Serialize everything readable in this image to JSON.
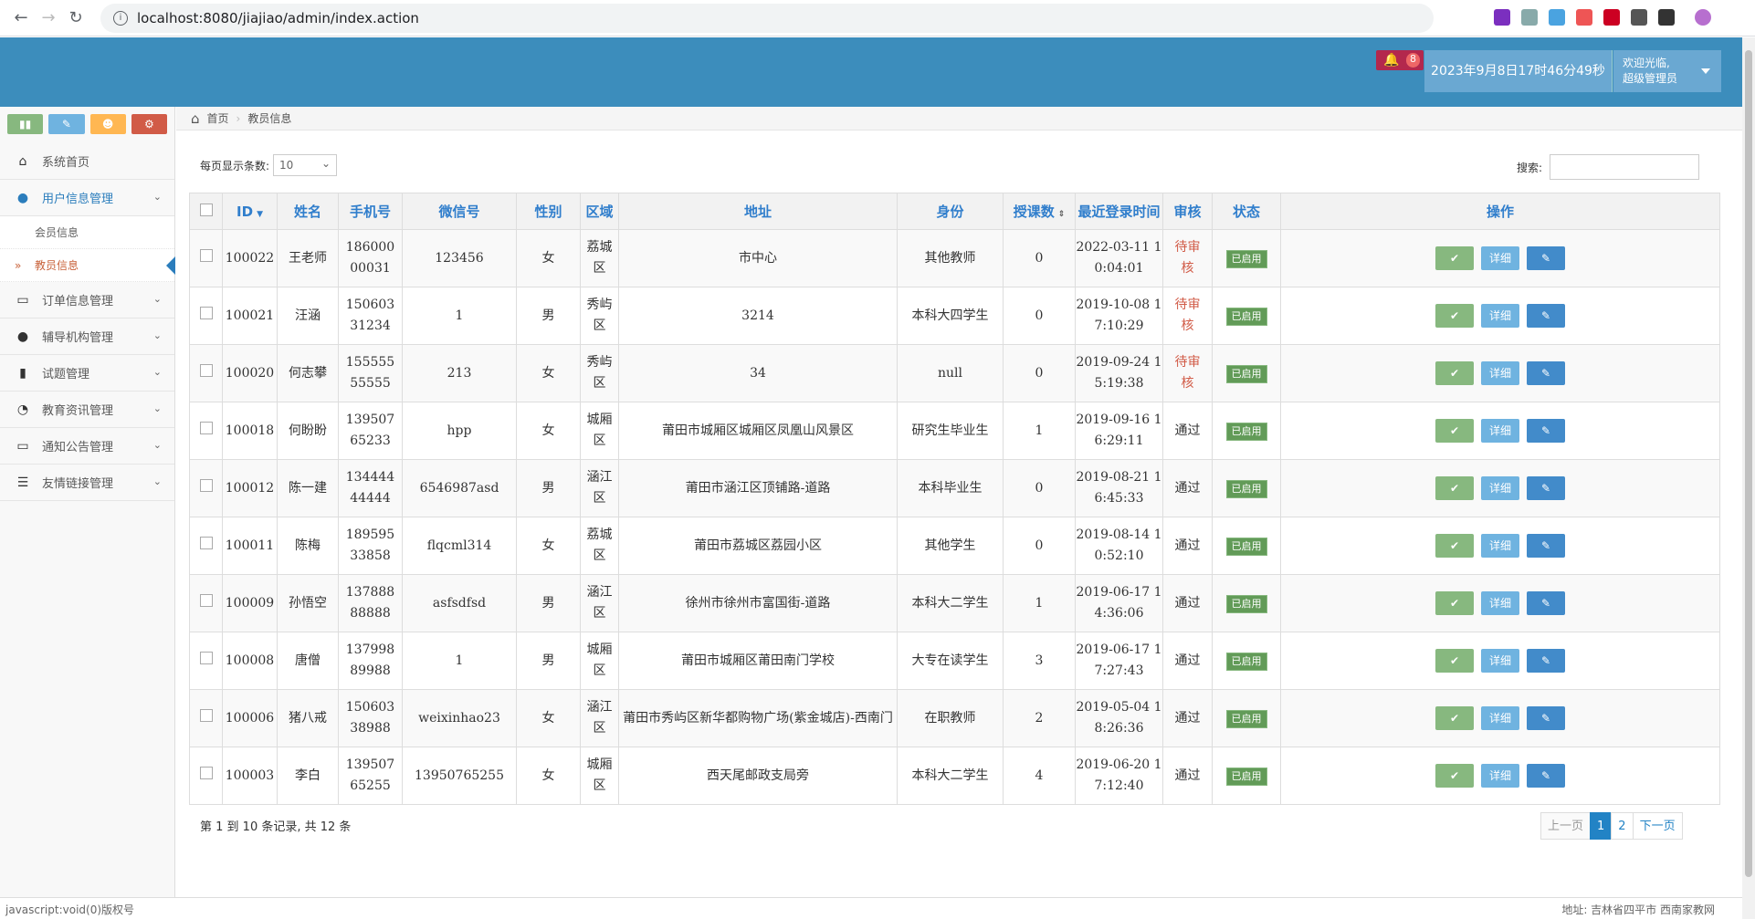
{
  "browser": {
    "url": "localhost:8080/jiajiao/admin/index.action"
  },
  "header": {
    "notification_count": "8",
    "datetime": "2023年9月8日17时46分49秒",
    "welcome": "欢迎光临,",
    "user_role": "超级管理员"
  },
  "sidebar": {
    "items": [
      {
        "label": "系统首页",
        "icon": "home-icon"
      },
      {
        "label": "用户信息管理",
        "icon": "user-icon",
        "subitems": [
          {
            "label": "会员信息"
          },
          {
            "label": "教员信息"
          }
        ]
      },
      {
        "label": "订单信息管理",
        "icon": "credit-card-icon"
      },
      {
        "label": "辅导机构管理",
        "icon": "user-icon"
      },
      {
        "label": "试题管理",
        "icon": "bookmark-icon"
      },
      {
        "label": "教育资讯管理",
        "icon": "comments-icon"
      },
      {
        "label": "通知公告管理",
        "icon": "desktop-icon"
      },
      {
        "label": "友情链接管理",
        "icon": "list-icon"
      }
    ]
  },
  "breadcrumb": {
    "home": "首页",
    "current": "教员信息"
  },
  "controls": {
    "page_size_label": "每页显示条数:",
    "page_size": "10",
    "search_label": "搜索:"
  },
  "table": {
    "columns": [
      "ID",
      "姓名",
      "手机号",
      "微信号",
      "性别",
      "区域",
      "地址",
      "身份",
      "授课数",
      "最近登录时间",
      "审核",
      "状态",
      "操作"
    ],
    "rows": [
      {
        "id": "100022",
        "name": "王老师",
        "phone": [
          "186000",
          "00031"
        ],
        "wechat": "123456",
        "gender": "女",
        "area": [
          "荔城",
          "区"
        ],
        "address": "市中心",
        "identity": "其他教师",
        "lessons": "0",
        "login": [
          "2022-03-11 1",
          "0:04:01"
        ],
        "review": [
          "待审",
          "核"
        ],
        "status": "已启用"
      },
      {
        "id": "100021",
        "name": "汪涵",
        "phone": [
          "150603",
          "31234"
        ],
        "wechat": "1",
        "gender": "男",
        "area": [
          "秀屿",
          "区"
        ],
        "address": "3214",
        "identity": "本科大四学生",
        "lessons": "0",
        "login": [
          "2019-10-08 1",
          "7:10:29"
        ],
        "review": [
          "待审",
          "核"
        ],
        "status": "已启用"
      },
      {
        "id": "100020",
        "name": "何志攀",
        "phone": [
          "155555",
          "55555"
        ],
        "wechat": "213",
        "gender": "女",
        "area": [
          "秀屿",
          "区"
        ],
        "address": "34",
        "identity": "null",
        "lessons": "0",
        "login": [
          "2019-09-24 1",
          "5:19:38"
        ],
        "review": [
          "待审",
          "核"
        ],
        "status": "已启用"
      },
      {
        "id": "100018",
        "name": "何盼盼",
        "phone": [
          "139507",
          "65233"
        ],
        "wechat": "hpp",
        "gender": "女",
        "area": [
          "城厢",
          "区"
        ],
        "address": "莆田市城厢区城厢区凤凰山风景区",
        "identity": "研究生毕业生",
        "lessons": "1",
        "login": [
          "2019-09-16 1",
          "6:29:11"
        ],
        "review": [
          "通过",
          ""
        ],
        "status": "已启用"
      },
      {
        "id": "100012",
        "name": "陈一建",
        "phone": [
          "134444",
          "44444"
        ],
        "wechat": "6546987asd",
        "gender": "男",
        "area": [
          "涵江",
          "区"
        ],
        "address": "莆田市涵江区顶铺路-道路",
        "identity": "本科毕业生",
        "lessons": "0",
        "login": [
          "2019-08-21 1",
          "6:45:33"
        ],
        "review": [
          "通过",
          ""
        ],
        "status": "已启用"
      },
      {
        "id": "100011",
        "name": "陈梅",
        "phone": [
          "189595",
          "33858"
        ],
        "wechat": "flqcml314",
        "gender": "女",
        "area": [
          "荔城",
          "区"
        ],
        "address": "莆田市荔城区荔园小区",
        "identity": "其他学生",
        "lessons": "0",
        "login": [
          "2019-08-14 1",
          "0:52:10"
        ],
        "review": [
          "通过",
          ""
        ],
        "status": "已启用"
      },
      {
        "id": "100009",
        "name": "孙悟空",
        "phone": [
          "137888",
          "88888"
        ],
        "wechat": "asfsdfsd",
        "gender": "男",
        "area": [
          "涵江",
          "区"
        ],
        "address": "徐州市徐州市富国街-道路",
        "identity": "本科大二学生",
        "lessons": "1",
        "login": [
          "2019-06-17 1",
          "4:36:06"
        ],
        "review": [
          "通过",
          ""
        ],
        "status": "已启用"
      },
      {
        "id": "100008",
        "name": "唐僧",
        "phone": [
          "137998",
          "89988"
        ],
        "wechat": "1",
        "gender": "男",
        "area": [
          "城厢",
          "区"
        ],
        "address": "莆田市城厢区莆田南门学校",
        "identity": "大专在读学生",
        "lessons": "3",
        "login": [
          "2019-06-17 1",
          "7:27:43"
        ],
        "review": [
          "通过",
          ""
        ],
        "status": "已启用"
      },
      {
        "id": "100006",
        "name": "猪八戒",
        "phone": [
          "150603",
          "38988"
        ],
        "wechat": "weixinhao23",
        "gender": "女",
        "area": [
          "涵江",
          "区"
        ],
        "address": "莆田市秀屿区新华都购物广场(紫金城店)-西南门",
        "identity": "在职教师",
        "lessons": "2",
        "login": [
          "2019-05-04 1",
          "8:26:36"
        ],
        "review": [
          "通过",
          ""
        ],
        "status": "已启用"
      },
      {
        "id": "100003",
        "name": "李白",
        "phone": [
          "139507",
          "65255"
        ],
        "wechat": "13950765255",
        "gender": "女",
        "area": [
          "城厢",
          "区"
        ],
        "address": "西天尾邮政支局旁",
        "identity": "本科大二学生",
        "lessons": "4",
        "login": [
          "2019-06-20 1",
          "7:12:40"
        ],
        "review": [
          "通过",
          ""
        ],
        "status": "已启用"
      }
    ],
    "detail_label": "详细"
  },
  "pagination": {
    "info": "第 1 到 10 条记录, 共 12 条",
    "prev": "上一页",
    "pages": [
      "1",
      "2"
    ],
    "next": "下一页"
  },
  "footer": {
    "left": "javascript:void(0)版权号",
    "right": "地址: 吉林省四平市 西南家教网"
  },
  "colors": {
    "topbar": "#3c8dbc",
    "accent": "#307ecc",
    "status": "#629b58",
    "pending": "#d15b47"
  }
}
